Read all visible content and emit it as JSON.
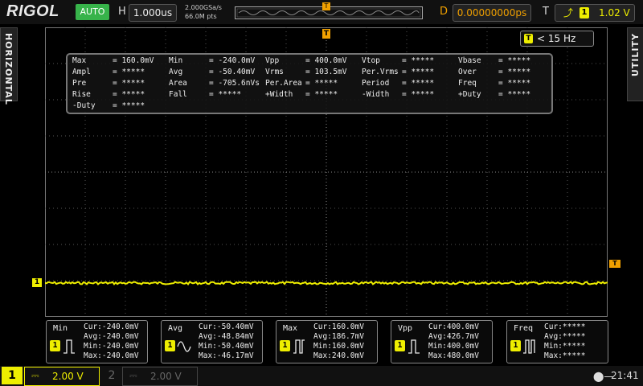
{
  "header": {
    "brand": "RIGOL",
    "mode": "AUTO",
    "h_label": "H",
    "timebase": "1.000us",
    "sample_rate": "2.000GSa/s",
    "memory_depth": "66.0M pts",
    "d_label": "D",
    "delay": "0.00000000ps",
    "t_label": "T",
    "trigger_channel": "1",
    "trigger_level": "1.02 V"
  },
  "side": {
    "left_tab": "HORIZONTAL",
    "right_tab": "UTILITY"
  },
  "freq_counter": {
    "badge": "T",
    "value": "< 15 Hz"
  },
  "measurements": [
    {
      "label": "Max",
      "value": "= 160.0mV"
    },
    {
      "label": "Min",
      "value": "= -240.0mV"
    },
    {
      "label": "Vpp",
      "value": "= 400.0mV"
    },
    {
      "label": "Vtop",
      "value": "= *****"
    },
    {
      "label": "Vbase",
      "value": "= *****"
    },
    {
      "label": "Ampl",
      "value": "= *****"
    },
    {
      "label": "Avg",
      "value": "= -50.40mV"
    },
    {
      "label": "Vrms",
      "value": "= 103.5mV"
    },
    {
      "label": "Per.Vrms",
      "value": "= *****"
    },
    {
      "label": "Over",
      "value": "= *****"
    },
    {
      "label": "Pre",
      "value": "= *****"
    },
    {
      "label": "Area",
      "value": "= -705.6nVs"
    },
    {
      "label": "Per.Area",
      "value": "= *****"
    },
    {
      "label": "Period",
      "value": "= *****"
    },
    {
      "label": "Freq",
      "value": "= *****"
    },
    {
      "label": "Rise",
      "value": "= *****"
    },
    {
      "label": "Fall",
      "value": "= *****"
    },
    {
      "label": "+Width",
      "value": "= *****"
    },
    {
      "label": "-Width",
      "value": "= *****"
    },
    {
      "label": "+Duty",
      "value": "= *****"
    },
    {
      "label": "-Duty",
      "value": "= *****"
    }
  ],
  "stats": [
    {
      "name": "Min",
      "badge": "1",
      "cur": "Cur:-240.0mV",
      "avg": "Avg:-240.0mV",
      "min": "Min:-240.0mV",
      "max": "Max:-240.0mV"
    },
    {
      "name": "Avg",
      "badge": "1",
      "cur": "Cur:-50.40mV",
      "avg": "Avg:-48.84mV",
      "min": "Min:-50.40mV",
      "max": "Max:-46.17mV"
    },
    {
      "name": "Max",
      "badge": "1",
      "cur": "Cur:160.0mV",
      "avg": "Avg:186.7mV",
      "min": "Min:160.0mV",
      "max": "Max:240.0mV"
    },
    {
      "name": "Vpp",
      "badge": "1",
      "cur": "Cur:400.0mV",
      "avg": "Avg:426.7mV",
      "min": "Min:400.0mV",
      "max": "Max:480.0mV"
    },
    {
      "name": "Freq",
      "badge": "1",
      "cur": "Cur:*****",
      "avg": "Avg:*****",
      "min": "Min:*****",
      "max": "Max:*****"
    }
  ],
  "channels": {
    "ch1_label": "1",
    "ch1_scale": "2.00 V",
    "ch2_label": "2",
    "ch2_scale": "2.00 V"
  },
  "markers": {
    "ch1_marker": "1",
    "trigger_top": "T",
    "trigger_right": "T"
  },
  "status": {
    "clock": "21:41"
  },
  "colors": {
    "ch1": "#eeee00",
    "auto": "#37b34a",
    "delay": "#f0a000"
  }
}
